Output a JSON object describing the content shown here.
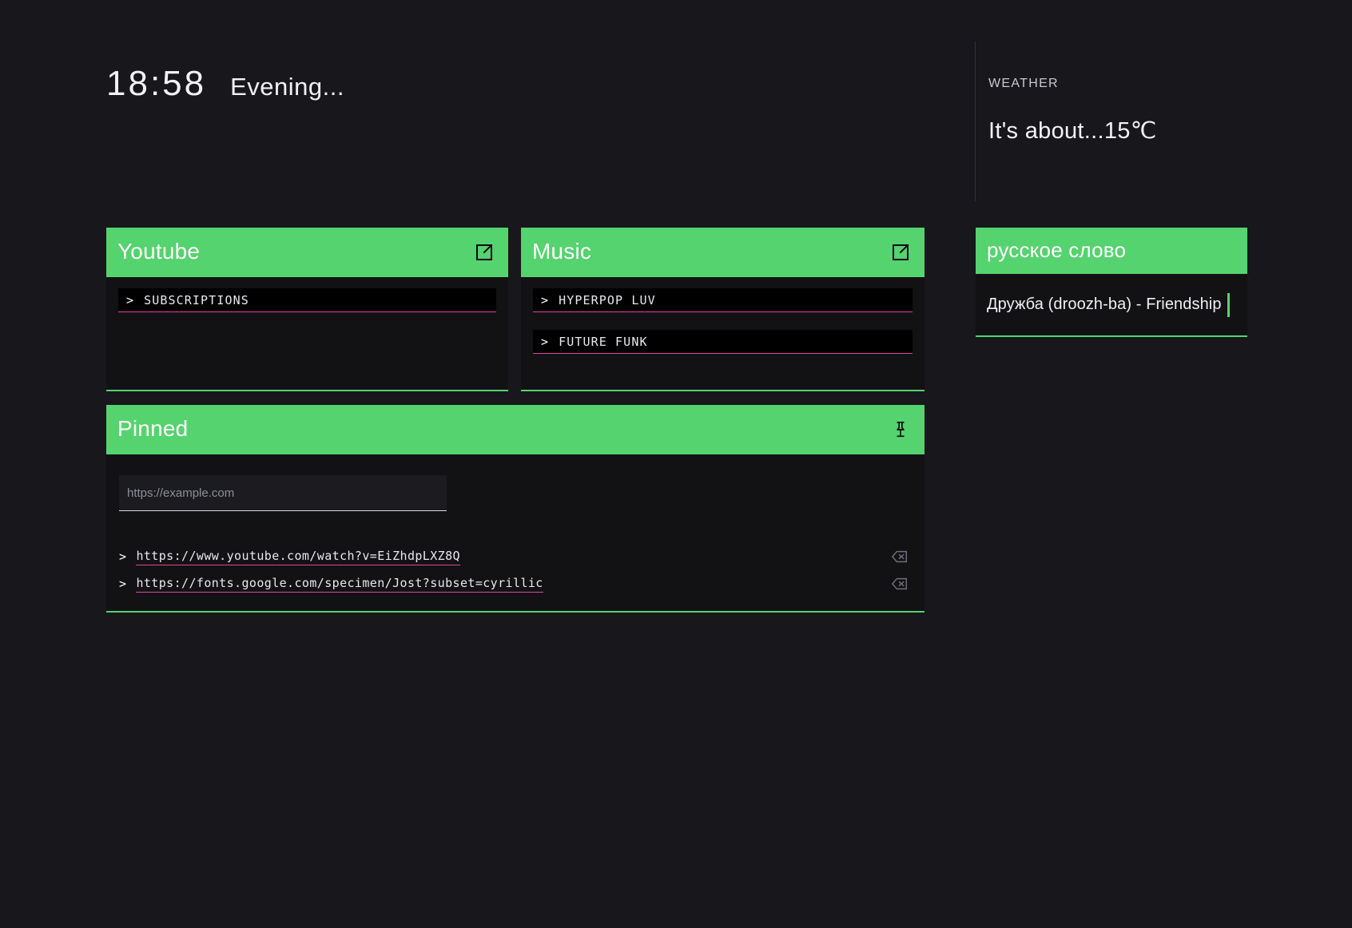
{
  "topbar": {
    "clock": {
      "time": "18:58",
      "greeting": "Evening..."
    },
    "weather": {
      "label": "WEATHER",
      "value": "It's about...15℃"
    }
  },
  "colors": {
    "accent_green": "#55d36e",
    "item_underline_pink": "#e0479b",
    "page_background": "#17171c",
    "card_background": "#121215",
    "item_background": "#000000"
  },
  "cards": {
    "youtube": {
      "title": "Youtube",
      "icon": "external-link-icon",
      "items": [
        {
          "caret": ">",
          "label": "SUBSCRIPTIONS"
        }
      ]
    },
    "music": {
      "title": "Music",
      "icon": "external-link-icon",
      "items": [
        {
          "caret": ">",
          "label": "HYPERPOP LUV"
        },
        {
          "caret": ">",
          "label": "FUTURE FUNK"
        }
      ]
    },
    "pinned": {
      "title": "Pinned",
      "icon": "pin-icon",
      "input": {
        "value": "",
        "placeholder": "https://example.com"
      },
      "links": [
        {
          "caret": ">",
          "url": "https://www.youtube.com/watch?v=EiZhdpLXZ8Q",
          "delete_icon": "backspace-delete-icon"
        },
        {
          "caret": ">",
          "url": "https://fonts.google.com/specimen/Jost?subset=cyrillic",
          "delete_icon": "backspace-delete-icon"
        }
      ]
    },
    "russian": {
      "title": "русское слово",
      "word": "Дружба (droozh-ba) - Friendship"
    }
  }
}
